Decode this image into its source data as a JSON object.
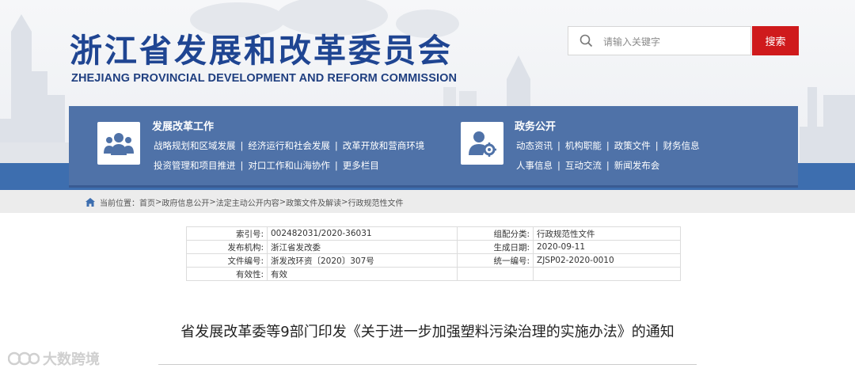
{
  "header": {
    "title_cn": "浙江省发展和改革委员会",
    "title_en": "ZHEJIANG PROVINCIAL DEVELOPMENT AND REFORM COMMISSION"
  },
  "search": {
    "placeholder": "请输入关键字",
    "button_label": "搜索"
  },
  "nav": {
    "left": {
      "title": "发展改革工作",
      "row1": [
        "战略规划和区域发展",
        "经济运行和社会发展",
        "改革开放和营商环境"
      ],
      "row2": [
        "投资管理和项目推进",
        "对口工作和山海协作",
        "更多栏目"
      ]
    },
    "right": {
      "title": "政务公开",
      "row1": [
        "动态资讯",
        "机构职能",
        "政策文件",
        "财务信息"
      ],
      "row2": [
        "人事信息",
        "互动交流",
        "新闻发布会"
      ]
    }
  },
  "breadcrumb": {
    "prefix": "当前位置：",
    "items": [
      "首页",
      "政府信息公开",
      "法定主动公开内容",
      "政策文件及解读",
      "行政规范性文件"
    ]
  },
  "info": {
    "index_label": "索引号:",
    "index_value": "002482031/2020-36031",
    "category_label": "组配分类:",
    "category_value": "行政规范性文件",
    "org_label": "发布机构:",
    "org_value": "浙江省发改委",
    "date_label": "生成日期:",
    "date_value": "2020-09-11",
    "docno_label": "文件编号:",
    "docno_value": "浙发改环资〔2020〕307号",
    "uniform_label": "统一编号:",
    "uniform_value": "ZJSP02-2020-0010",
    "validity_label": "有效性:",
    "validity_value": "有效"
  },
  "document": {
    "title": "省发展改革委等9部门印发《关于进一步加强塑料污染治理的实施办法》的通知"
  },
  "watermark": {
    "text": "大数跨境"
  },
  "colors": {
    "brand_blue": "#1f4592",
    "nav_blue": "#4f72a8",
    "search_red": "#cf1a1c"
  }
}
